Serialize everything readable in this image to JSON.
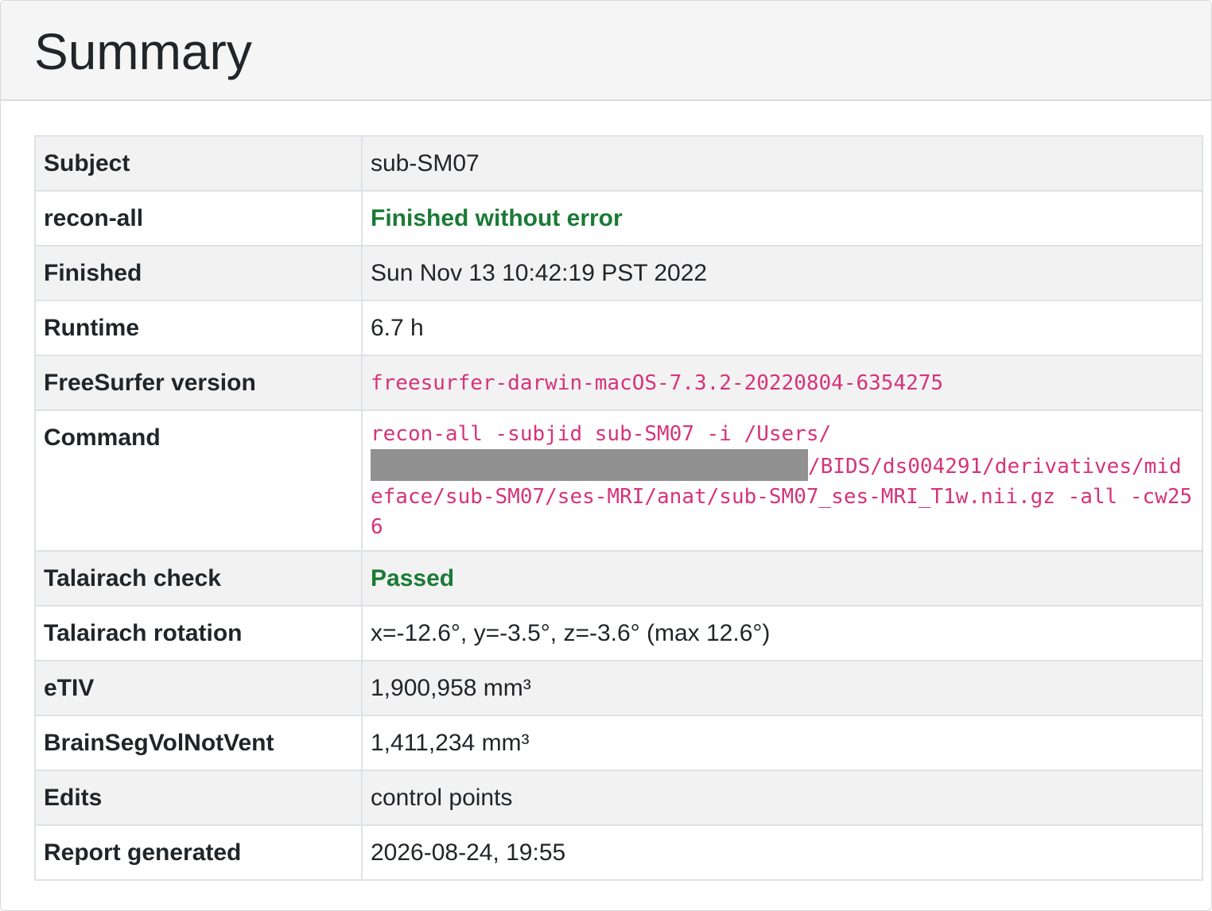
{
  "header": {
    "title": "Summary"
  },
  "rows": [
    {
      "key": "Subject",
      "value": "sub-SM07"
    },
    {
      "key": "recon-all",
      "value": "Finished without error"
    },
    {
      "key": "Finished",
      "value": "Sun Nov 13 10:42:19 PST 2022"
    },
    {
      "key": "Runtime",
      "value": "6.7 h"
    },
    {
      "key": "FreeSurfer version",
      "value": "freesurfer-darwin-macOS-7.3.2-20220804-6354275"
    },
    {
      "key": "Command",
      "value_before": "recon-all -subjid sub-SM07 -i /Users/",
      "value_after": "/BIDS/ds004291/derivatives/mideface/sub-SM07/ses-MRI/anat/sub-SM07_ses-MRI_T1w.nii.gz -all -cw256"
    },
    {
      "key": "Talairach check",
      "value": "Passed"
    },
    {
      "key": "Talairach rotation",
      "value": "x=-12.6°, y=-3.5°, z=-3.6° (max 12.6°)"
    },
    {
      "key": "eTIV",
      "value": "1,900,958 mm³"
    },
    {
      "key": "BrainSegVolNotVent",
      "value": "1,411,234 mm³"
    },
    {
      "key": "Edits",
      "value": "control points"
    },
    {
      "key": "Report generated",
      "value": "2026-08-24, 19:55"
    }
  ],
  "colors": {
    "success": "#1a7a35",
    "code": "#d6337a",
    "redaction": "#919191"
  }
}
